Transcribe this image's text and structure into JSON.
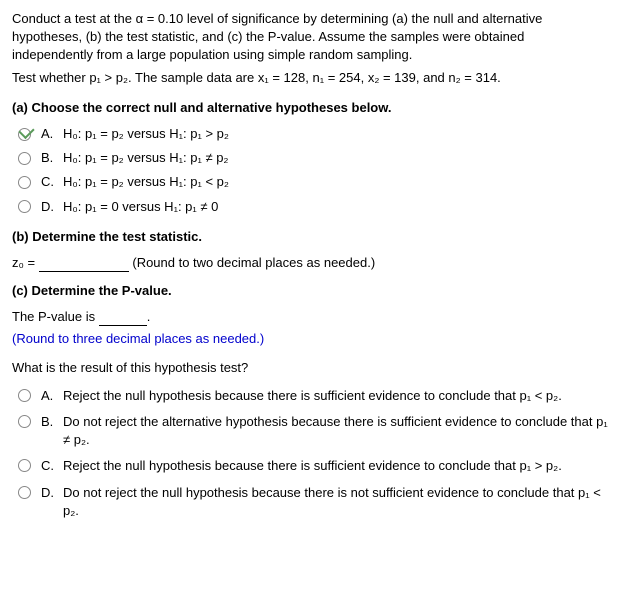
{
  "intro": "Conduct a test at the α = 0.10 level of significance by determining (a) the null and alternative hypotheses, (b) the test statistic, and (c) the P-value. Assume the samples were obtained independently from a large population using simple random sampling.",
  "test_line": "Test whether p₁ > p₂. The sample data are x₁ = 128, n₁ = 254, x₂ = 139, and n₂ = 314.",
  "partA": {
    "prompt": "(a) Choose the correct null and alternative hypotheses below.",
    "opts": {
      "A": {
        "label": "A.",
        "text": "H₀: p₁ = p₂ versus H₁: p₁ > p₂"
      },
      "B": {
        "label": "B.",
        "text": "H₀: p₁ = p₂ versus H₁: p₁ ≠ p₂"
      },
      "C": {
        "label": "C.",
        "text": "H₀: p₁ = p₂ versus H₁: p₁ < p₂"
      },
      "D": {
        "label": "D.",
        "text": "H₀: p₁ = 0 versus H₁: p₁ ≠ 0"
      }
    }
  },
  "partB": {
    "prompt": "(b) Determine the test statistic.",
    "var": "z₀ =",
    "hint": "(Round to two decimal places as needed.)"
  },
  "partC": {
    "prompt": "(c) Determine the P-value.",
    "line": "The P-value is",
    "hint": "(Round to three decimal places as needed.)"
  },
  "resultQ": "What is the result of this hypothesis test?",
  "result": {
    "A": {
      "label": "A.",
      "text": "Reject the null hypothesis because there is sufficient evidence to conclude that p₁ < p₂."
    },
    "B": {
      "label": "B.",
      "text": "Do not reject the alternative hypothesis because there is sufficient evidence to conclude that p₁ ≠ p₂."
    },
    "C": {
      "label": "C.",
      "text": "Reject the null hypothesis because there is sufficient evidence to conclude that p₁ > p₂."
    },
    "D": {
      "label": "D.",
      "text": "Do not reject the null hypothesis because there is not sufficient evidence to conclude that p₁ < p₂."
    }
  }
}
